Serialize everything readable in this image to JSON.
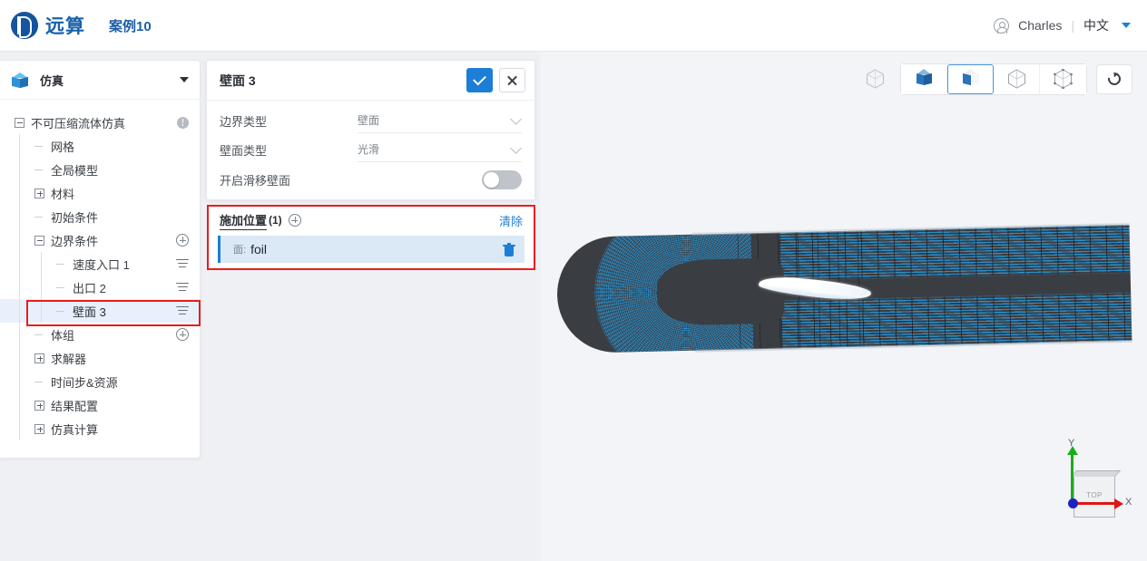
{
  "topbar": {
    "brand_name": "远算",
    "case_name": "案例10",
    "user_name": "Charles",
    "divider": "|",
    "language": "中文",
    "avatar_icon": "user-circle-icon",
    "caret_icon": "caret-down-icon",
    "accent_color": "#1c7ed6",
    "brand_color": "#1862ab"
  },
  "sidebar": {
    "icon": "cube-icon",
    "title": "仿真",
    "collapse_icon": "caret-down-icon",
    "tree": [
      {
        "label": "不可压缩流体仿真",
        "level": 0,
        "expander": "minus",
        "right_icon": "info-icon",
        "selected": false
      },
      {
        "label": "网格",
        "level": 1,
        "expander": "stub",
        "right_icon": "",
        "selected": false
      },
      {
        "label": "全局模型",
        "level": 1,
        "expander": "stub",
        "right_icon": "",
        "selected": false
      },
      {
        "label": "材料",
        "level": 1,
        "expander": "plus",
        "right_icon": "",
        "selected": false
      },
      {
        "label": "初始条件",
        "level": 1,
        "expander": "stub",
        "right_icon": "",
        "selected": false
      },
      {
        "label": "边界条件",
        "level": 1,
        "expander": "minus",
        "right_icon": "plus-circle-icon",
        "selected": false
      },
      {
        "label": "速度入口 1",
        "level": 2,
        "expander": "stub",
        "right_icon": "list-lines-icon",
        "selected": false
      },
      {
        "label": "出口 2",
        "level": 2,
        "expander": "stub",
        "right_icon": "list-lines-icon",
        "selected": false
      },
      {
        "label": "壁面 3",
        "level": 2,
        "expander": "stub",
        "right_icon": "list-lines-icon",
        "selected": true
      },
      {
        "label": "体组",
        "level": 1,
        "expander": "stub",
        "right_icon": "plus-circle-icon",
        "selected": false
      },
      {
        "label": "求解器",
        "level": 1,
        "expander": "plus",
        "right_icon": "",
        "selected": false
      },
      {
        "label": "时间步&资源",
        "level": 1,
        "expander": "stub",
        "right_icon": "",
        "selected": false
      },
      {
        "label": "结果配置",
        "level": 1,
        "expander": "plus",
        "right_icon": "",
        "selected": false
      },
      {
        "label": "仿真计算",
        "level": 1,
        "expander": "plus",
        "right_icon": "",
        "selected": false
      }
    ]
  },
  "panel": {
    "title": "壁面 3",
    "confirm_icon": "check-icon",
    "cancel_icon": "close-icon",
    "rows": [
      {
        "label": "边界类型",
        "value": "壁面",
        "control": "select"
      },
      {
        "label": "壁面类型",
        "value": "光滑",
        "control": "select"
      }
    ],
    "toggle": {
      "label": "开启滑移壁面",
      "state": "off"
    }
  },
  "location_section": {
    "title": "施加位置",
    "count": "(1)",
    "add_icon": "plus-circle-icon",
    "clear_label": "清除",
    "highlight_color": "#e81d1d",
    "items": [
      {
        "type_tag": "面:",
        "name": "foil",
        "delete_icon": "trash-icon"
      }
    ]
  },
  "viewport": {
    "toolbar": [
      {
        "name": "cube-outline-standalone-button",
        "icon": "cube-outline-icon",
        "active": false,
        "group": "loose"
      },
      {
        "name": "view-solid-button",
        "icon": "cube-solid-icon",
        "active": false,
        "group": "main"
      },
      {
        "name": "view-surface-button",
        "icon": "cube-half-icon",
        "active": true,
        "group": "main"
      },
      {
        "name": "view-wireframe-button",
        "icon": "cube-wire-icon",
        "active": false,
        "group": "main"
      },
      {
        "name": "view-points-button",
        "icon": "cube-points-icon",
        "active": false,
        "group": "main"
      },
      {
        "name": "reset-view-button",
        "icon": "refresh-icon",
        "active": false,
        "group": "single"
      }
    ],
    "gizmo": {
      "face_label": "TOP",
      "axis_y": "Y",
      "axis_x": "X",
      "color_y": "#16b016",
      "color_x": "#e01515",
      "color_origin": "#1b23c4"
    },
    "model": {
      "description": "airfoil-cfd-mesh",
      "highlighted_surface": "foil",
      "mesh_color": "#2996d7",
      "body_color": "#3a3d42"
    }
  }
}
